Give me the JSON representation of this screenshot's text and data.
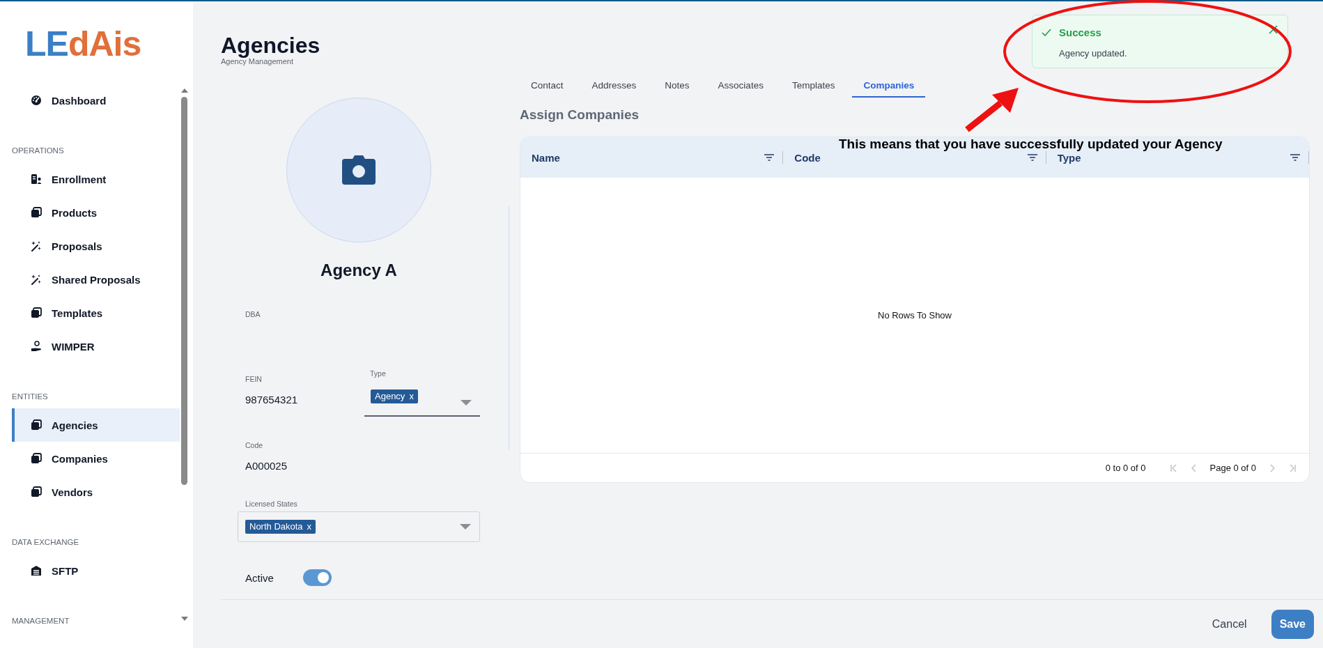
{
  "logo": {
    "first": "LE",
    "second": "dAis"
  },
  "sidebar": {
    "sections": [
      {
        "items": [
          {
            "label": "Dashboard",
            "kind": "gauge",
            "selected": false
          }
        ]
      },
      {
        "heading": "OPERATIONS",
        "items": [
          {
            "label": "Enrollment",
            "kind": "idcard",
            "selected": false
          },
          {
            "label": "Products",
            "kind": "stack",
            "selected": false
          },
          {
            "label": "Proposals",
            "kind": "wand",
            "selected": false
          },
          {
            "label": "Shared Proposals",
            "kind": "wand",
            "selected": false
          },
          {
            "label": "Templates",
            "kind": "stack",
            "selected": false
          },
          {
            "label": "WIMPER",
            "kind": "hand",
            "selected": false
          }
        ]
      },
      {
        "heading": "ENTITIES",
        "items": [
          {
            "label": "Agencies",
            "kind": "stack",
            "selected": true
          },
          {
            "label": "Companies",
            "kind": "stack",
            "selected": false
          },
          {
            "label": "Vendors",
            "kind": "stack",
            "selected": false
          }
        ]
      },
      {
        "heading": "DATA EXCHANGE",
        "items": [
          {
            "label": "SFTP",
            "kind": "garage",
            "selected": false
          }
        ]
      },
      {
        "heading": "MANAGEMENT"
      }
    ]
  },
  "header": {
    "title": "Agencies",
    "subtitle": "Agency Management"
  },
  "profile": {
    "name": "Agency A",
    "dba": {
      "label": "DBA"
    },
    "fein": {
      "label": "FEIN",
      "value": "987654321"
    },
    "type": {
      "label": "Type",
      "tags": [
        {
          "label": "Agency",
          "remove": "x"
        }
      ]
    },
    "code": {
      "label": "Code",
      "value": "A000025"
    },
    "licensed_states": {
      "label": "Licensed States",
      "tags": [
        {
          "label": "North Dakota",
          "remove": "x"
        }
      ]
    },
    "active": {
      "label": "Active",
      "on": true
    }
  },
  "tabs": [
    {
      "label": "Contact",
      "selected": false
    },
    {
      "label": "Addresses",
      "selected": false
    },
    {
      "label": "Notes",
      "selected": false
    },
    {
      "label": "Associates",
      "selected": false
    },
    {
      "label": "Templates",
      "selected": false
    },
    {
      "label": "Companies",
      "selected": true
    }
  ],
  "assign": {
    "title": "Assign Companies",
    "columns": [
      "Name",
      "Code",
      "Type"
    ],
    "empty_text": "No Rows To Show",
    "range": "0 to 0 of 0",
    "page": "Page 0 of 0"
  },
  "footer": {
    "buttons": [
      {
        "label": "Cancel",
        "kind": "text"
      },
      {
        "label": "Save",
        "kind": "primary"
      }
    ]
  },
  "toast": {
    "title": "Success",
    "message": "Agency updated."
  },
  "annotation": {
    "text": "This means that you have successfully updated your Agency"
  }
}
